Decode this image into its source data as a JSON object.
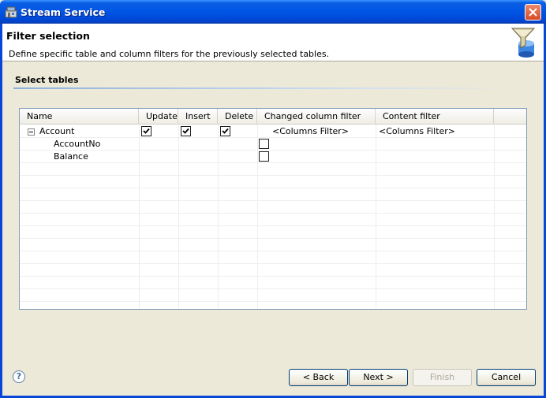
{
  "window": {
    "title": "Stream Service"
  },
  "header": {
    "title": "Filter selection",
    "description": "Define specific table and column filters for the previously selected tables."
  },
  "section": {
    "title": "Select tables"
  },
  "table": {
    "columns": [
      "Name",
      "Update",
      "Insert",
      "Delete",
      "Changed column filter",
      "Content filter"
    ],
    "rows": [
      {
        "name": "Account",
        "expanded": true,
        "update": true,
        "insert": true,
        "delete": true,
        "changed_filter": "<Columns Filter>",
        "content_filter": "<Columns Filter>"
      },
      {
        "name": "AccountNo",
        "changed_checkbox": false
      },
      {
        "name": "Balance",
        "changed_checkbox": false
      }
    ]
  },
  "buttons": {
    "back": "< Back",
    "next": "Next >",
    "finish": "Finish",
    "cancel": "Cancel"
  },
  "colors": {
    "titlebar": "#0055e5",
    "frame": "#0846d8",
    "background": "#ece9d8"
  },
  "icons": {
    "help": "help-icon",
    "app": "app-icon",
    "header": "filter-database-icon",
    "close": "close-icon"
  }
}
